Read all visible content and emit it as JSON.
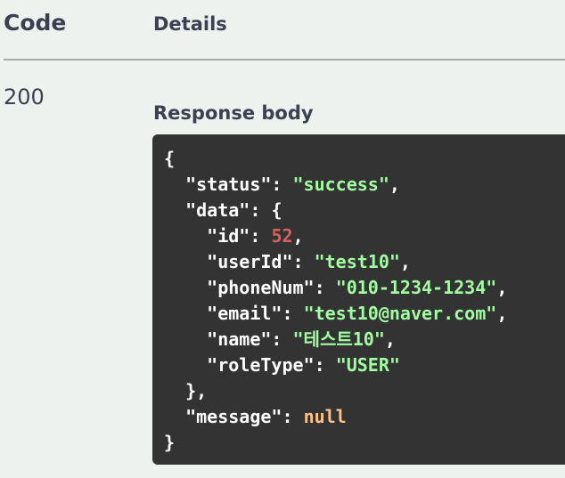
{
  "headers": {
    "code": "Code",
    "details": "Details"
  },
  "response": {
    "status_code": "200",
    "body_label": "Response body",
    "lines": [
      {
        "open": "{"
      },
      {
        "key": "\"status\"",
        "sep": ": ",
        "value": "\"success\"",
        "tail": ","
      },
      {
        "key": "\"data\"",
        "sep": ": ",
        "tail": "{"
      },
      {
        "key": "\"id\"",
        "sep": ": ",
        "value": "52",
        "tail": ","
      },
      {
        "key": "\"userId\"",
        "sep": ": ",
        "value": "\"test10\"",
        "tail": ","
      },
      {
        "key": "\"phoneNum\"",
        "sep": ": ",
        "value": "\"010-1234-1234\"",
        "tail": ","
      },
      {
        "key": "\"email\"",
        "sep": ": ",
        "value": "\"test10@naver.com\"",
        "tail": ","
      },
      {
        "key": "\"name\"",
        "sep": ": ",
        "value": "\"테스트10\"",
        "tail": ","
      },
      {
        "key": "\"roleType\"",
        "sep": ": ",
        "value": "\"USER\""
      },
      {
        "close": "},"
      },
      {
        "key": "\"message\"",
        "sep": ": ",
        "value": "null"
      },
      {
        "close": "}"
      }
    ]
  },
  "colors": {
    "background": "#edf2ee",
    "code_background": "#333333",
    "string": "#a2fca2",
    "number": "#d36363",
    "null": "#fcc28c",
    "text": "#3b4151"
  }
}
